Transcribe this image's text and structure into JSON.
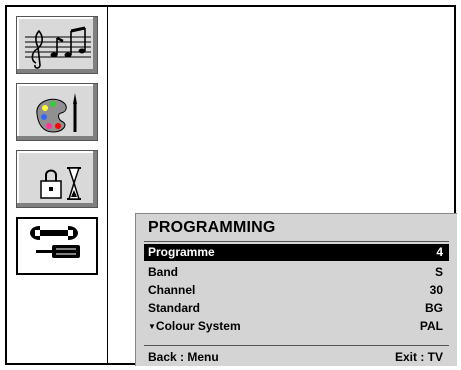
{
  "sidebar": {
    "items": [
      {
        "icon": "music-notes-icon",
        "selected": false
      },
      {
        "icon": "paint-palette-icon",
        "selected": false
      },
      {
        "icon": "lock-timer-icon",
        "selected": false
      },
      {
        "icon": "wrench-screwdriver-icon",
        "selected": true
      }
    ]
  },
  "panel": {
    "title": "PROGRAMMING",
    "rows": [
      {
        "label": "Programme",
        "value": "4",
        "highlighted": true
      },
      {
        "label": "Band",
        "value": "S"
      },
      {
        "label": "Channel",
        "value": "30"
      },
      {
        "label": "Standard",
        "value": "BG"
      },
      {
        "label": "Colour System",
        "value": "PAL",
        "arrow": "▼"
      }
    ],
    "footer": {
      "left": "Back : Menu",
      "right": "Exit : TV"
    }
  }
}
